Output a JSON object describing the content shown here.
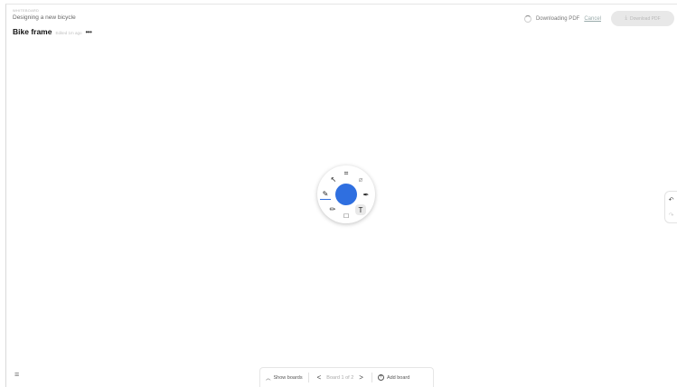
{
  "header": {
    "kicker": "WHITEBOARD",
    "project": "Designing a new bicycle",
    "board_title": "Bike frame",
    "board_meta": "Edited 1m ago",
    "more_label": "•••"
  },
  "download": {
    "status": "Downloading PDF",
    "cancel": "Cancel",
    "button_label": "Download PDF",
    "button_icon": "⤓"
  },
  "dial": {
    "accent": "#2f6fe0",
    "tools": {
      "select": "↖",
      "capture": "⌗",
      "eraser": "⌀",
      "pen": "✎",
      "pencil": "✏",
      "shape": "□",
      "text": "T",
      "marker": "✒"
    }
  },
  "side": {
    "undo": "↶",
    "redo": "↷"
  },
  "bottom": {
    "menu_icon": "≡",
    "show_boards_icon": "︿",
    "show_boards": "Show boards",
    "prev": "<",
    "board_count": "Board 1 of 2",
    "next": ">",
    "add_icon": "+",
    "add_board": "Add board"
  }
}
